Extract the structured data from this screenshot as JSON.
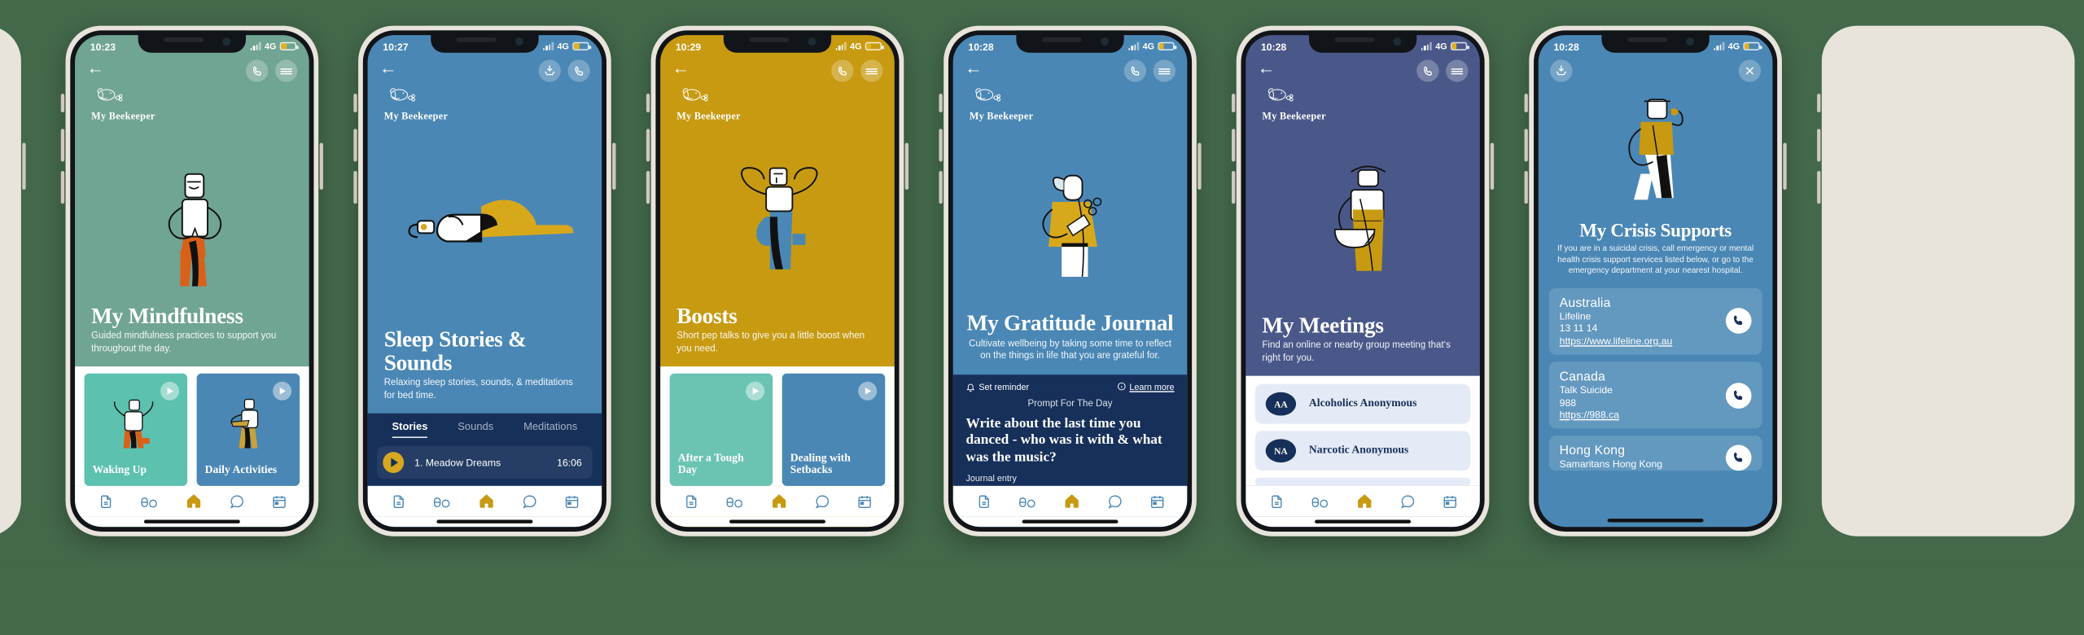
{
  "app": {
    "brand": "My Beekeeper",
    "logo_icon": "bee-logo-icon"
  },
  "nav": {
    "items": [
      {
        "name": "document-icon",
        "label": "Documents"
      },
      {
        "name": "pills-icon",
        "label": "Medication"
      },
      {
        "name": "home-icon",
        "label": "Home"
      },
      {
        "name": "chat-icon",
        "label": "Chat"
      },
      {
        "name": "calendar-icon",
        "label": "Calendar"
      }
    ]
  },
  "status_defaults": {
    "network": "4G",
    "signal_icon": "signal-bars-icon",
    "battery_icon": "battery-icon"
  },
  "phones": [
    {
      "id": "mindfulness",
      "time": "10:23",
      "network": "4G",
      "bg": "#70a493",
      "actions": [
        "phone-icon",
        "menu-icon"
      ],
      "title": "My Mindfulness",
      "subtitle": "Guided mindfulness practices to support you throughout the day.",
      "align": "left",
      "cards": [
        {
          "title": "Waking Up",
          "bg": "#5cc1ae"
        },
        {
          "title": "Daily Activities",
          "bg": "#4a87b5"
        }
      ]
    },
    {
      "id": "sleep",
      "time": "10:27",
      "network": "4G",
      "bg": "#4a87b5",
      "actions": [
        "download-icon",
        "phone-icon"
      ],
      "title": "Sleep Stories & Sounds",
      "subtitle": "Relaxing sleep stories, sounds, & meditations for bed time.",
      "align": "left",
      "tabs": [
        {
          "label": "Stories",
          "active": true
        },
        {
          "label": "Sounds",
          "active": false
        },
        {
          "label": "Meditations",
          "active": false
        }
      ],
      "tracks": [
        {
          "name": "1. Meadow Dreams",
          "duration": "16:06"
        }
      ]
    },
    {
      "id": "boosts",
      "time": "10:29",
      "network": "4G",
      "bg": "#c79a12",
      "actions": [
        "phone-icon",
        "menu-icon"
      ],
      "title": "Boosts",
      "subtitle": "Short pep talks to give you a little boost when you need.",
      "align": "left",
      "cards": [
        {
          "title": "After a Tough Day",
          "bg": "#6bc4b2"
        },
        {
          "title": "Dealing with Setbacks",
          "bg": "#4a87b5"
        }
      ]
    },
    {
      "id": "gratitude",
      "time": "10:28",
      "network": "4G",
      "bg": "#4a87b5",
      "actions": [
        "phone-icon",
        "menu-icon"
      ],
      "title": "My Gratitude Journal",
      "subtitle": "Cultivate wellbeing by taking some time to reflect on the things in life that you are grateful for.",
      "align": "center",
      "journal": {
        "set_reminder": "Set reminder",
        "reminder_icon": "bell-icon",
        "learn_more": "Learn more",
        "learn_more_icon": "info-icon",
        "prompt_label": "Prompt For The Day",
        "prompt": "Write about the last time you danced - who was it with & what was the music?",
        "entry_label": "Journal entry"
      }
    },
    {
      "id": "meetings",
      "time": "10:28",
      "network": "4G",
      "bg": "#4a5889",
      "actions": [
        "phone-icon",
        "menu-icon"
      ],
      "title": "My Meetings",
      "subtitle": "Find an online or nearby group meeting that‘s right for you.",
      "align": "left",
      "meetings": [
        {
          "badge": "AA",
          "label": "Alcoholics Anonymous"
        },
        {
          "badge": "NA",
          "label": "Narcotic Anonymous"
        }
      ]
    },
    {
      "id": "crisis",
      "time": "10:28",
      "network": "4G",
      "bg": "#4a87b5",
      "actions": [
        "download-icon",
        "close-icon"
      ],
      "title": "My Crisis Supports",
      "subtitle": "If you are in a suicidal crisis, call emergency or mental health crisis support services listed below, or go to the emergency department at your nearest hospital.",
      "align": "center",
      "supports": [
        {
          "country": "Australia",
          "service": "Lifeline",
          "number": "13 11 14",
          "url": "https://www.lifeline.org.au",
          "call_icon": "phone-icon"
        },
        {
          "country": "Canada",
          "service": "Talk Suicide",
          "number": "988",
          "url": "https://988.ca",
          "call_icon": "phone-icon"
        },
        {
          "country": "Hong Kong",
          "service": "Samaritans Hong Kong",
          "number": "",
          "url": "",
          "call_icon": "phone-icon"
        }
      ]
    }
  ]
}
